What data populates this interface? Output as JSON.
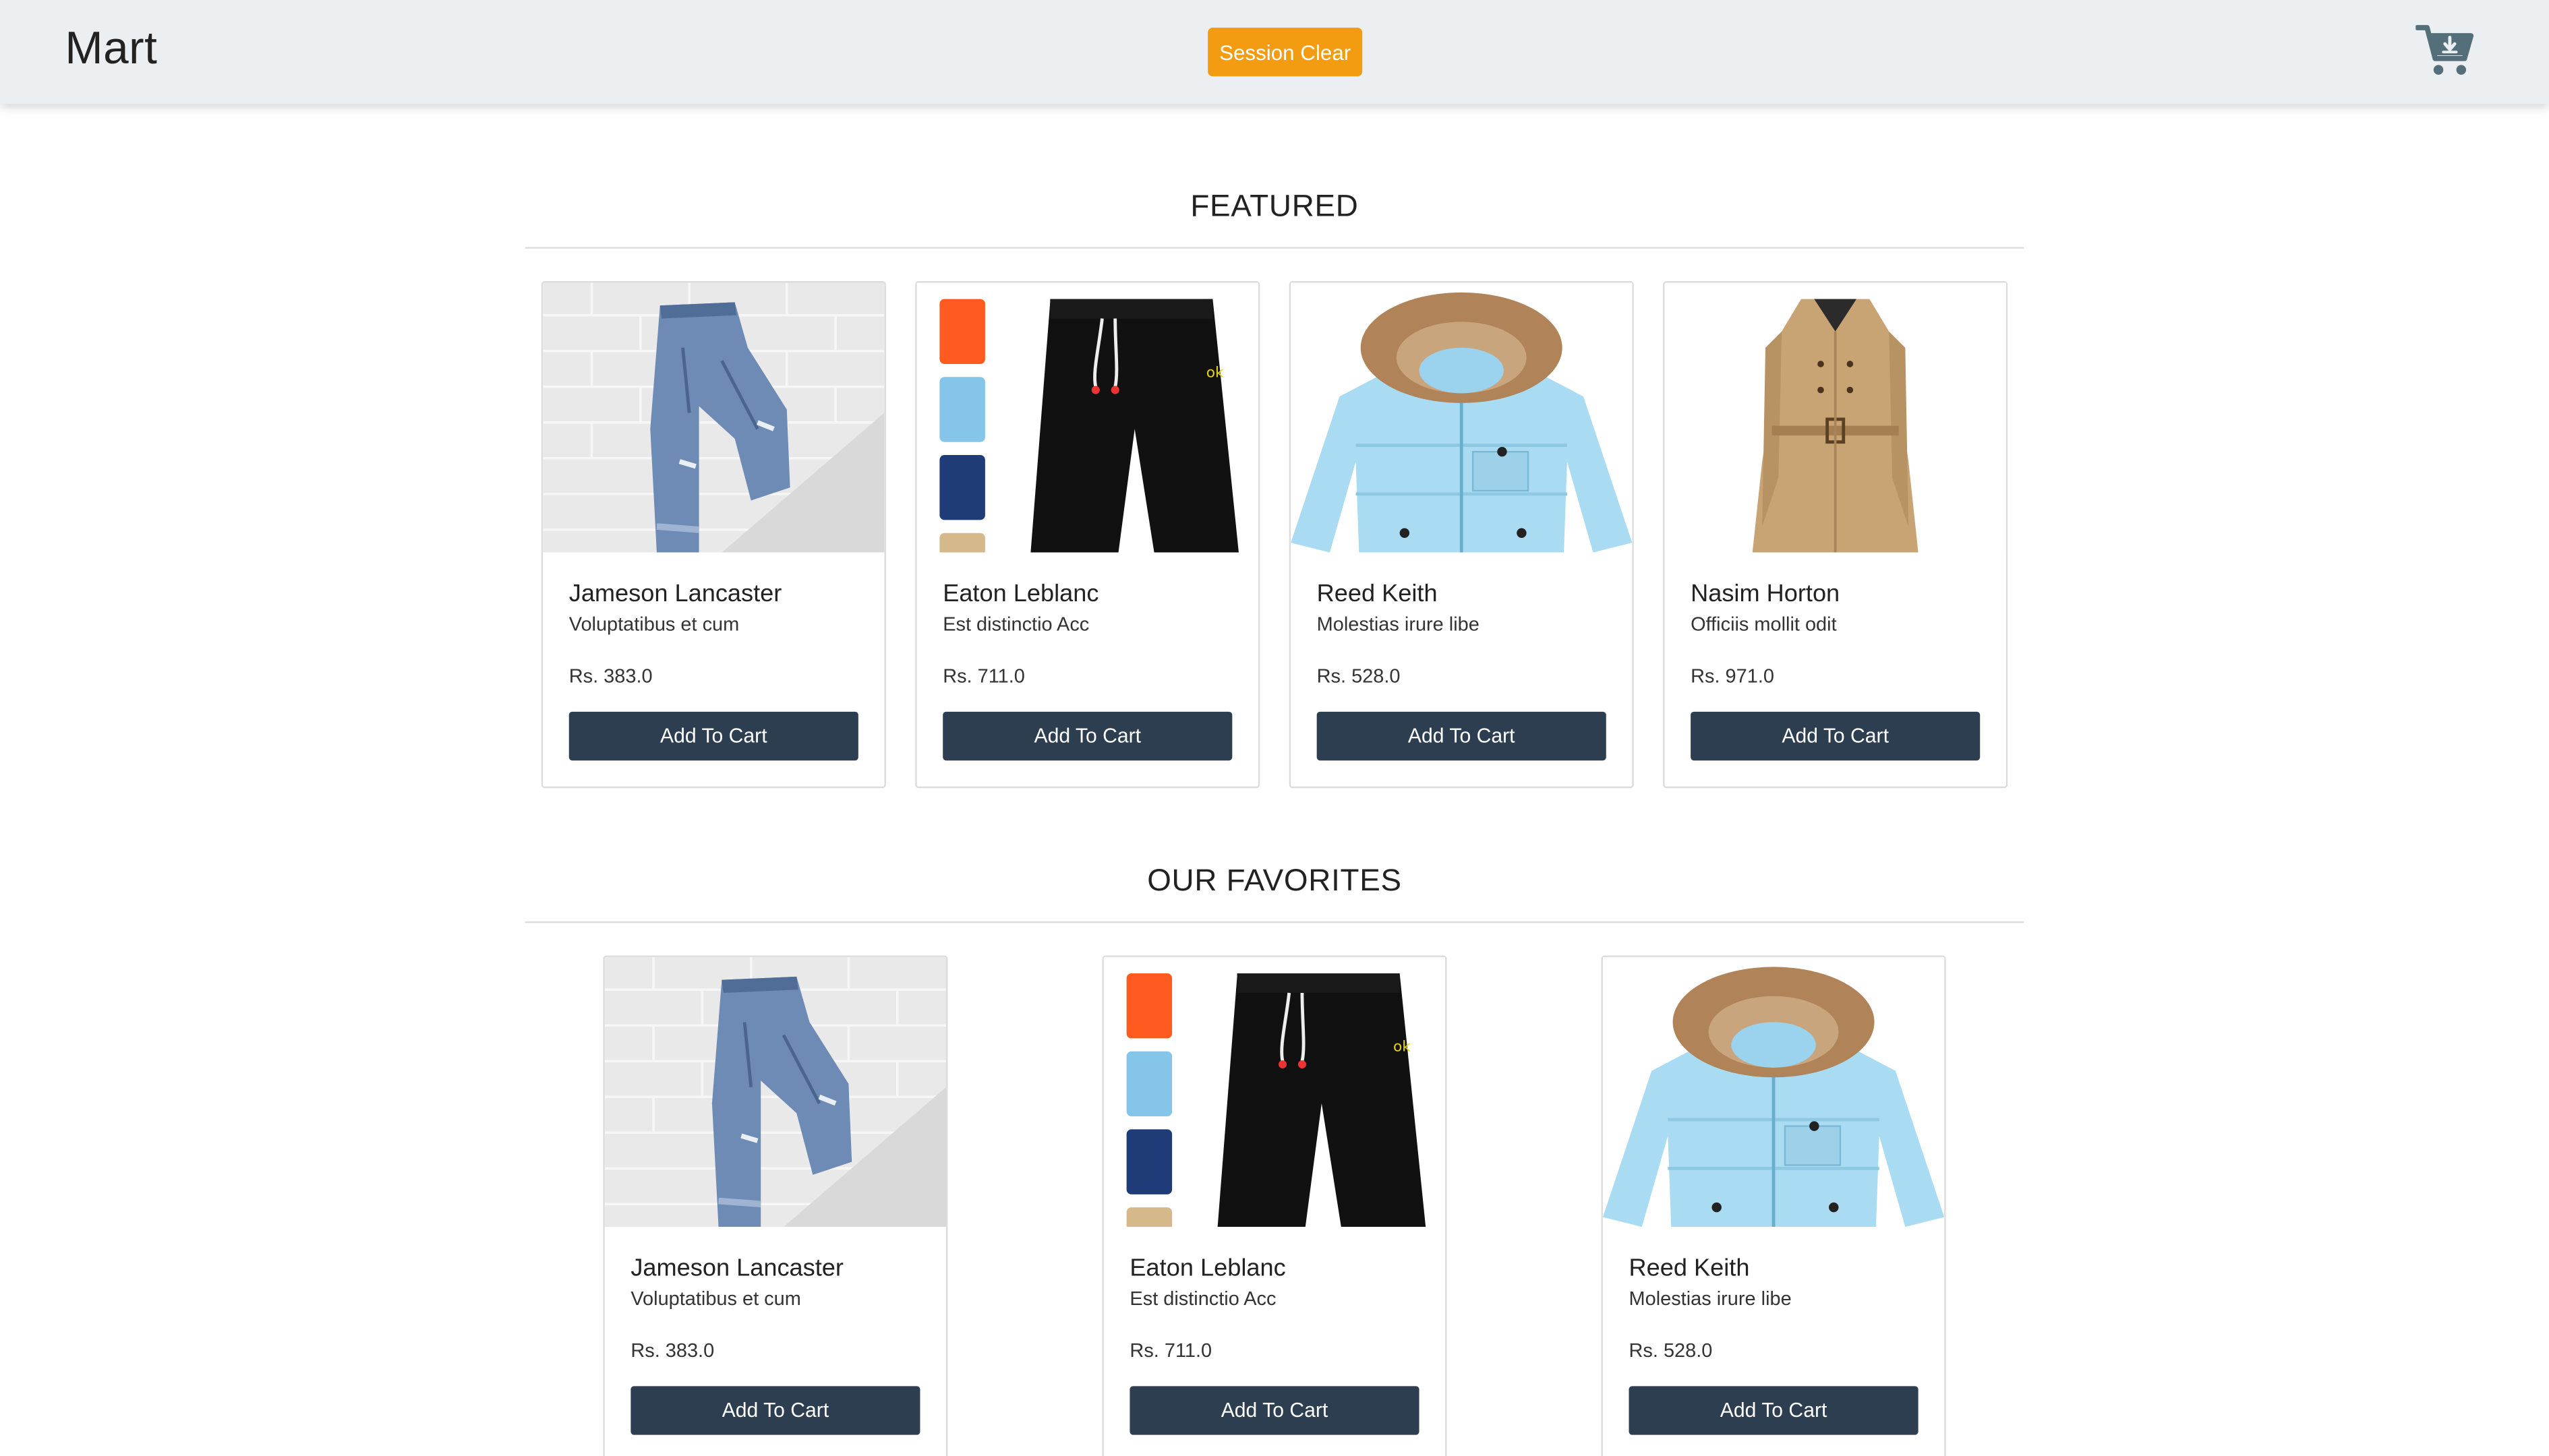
{
  "navbar": {
    "brand": "Mart",
    "session_clear_label": "Session Clear",
    "cart_icon": "cart-download-icon"
  },
  "sections": {
    "featured": {
      "title": "FEATURED",
      "products": [
        {
          "name": "Jameson Lancaster",
          "desc": "Voluptatibus et cum",
          "price": "Rs. 383.0",
          "button": "Add To Cart",
          "image": "jeans"
        },
        {
          "name": "Eaton Leblanc",
          "desc": "Est distinctio Acc",
          "price": "Rs. 711.0",
          "button": "Add To Cart",
          "image": "shorts"
        },
        {
          "name": "Reed Keith",
          "desc": "Molestias irure libe",
          "price": "Rs. 528.0",
          "button": "Add To Cart",
          "image": "puffer-jacket"
        },
        {
          "name": "Nasim Horton",
          "desc": "Officiis mollit odit",
          "price": "Rs. 971.0",
          "button": "Add To Cart",
          "image": "trench-coat"
        }
      ]
    },
    "favorites": {
      "title": "OUR FAVORITES",
      "products": [
        {
          "name": "Jameson Lancaster",
          "desc": "Voluptatibus et cum",
          "price": "Rs. 383.0",
          "button": "Add To Cart",
          "image": "jeans"
        },
        {
          "name": "Eaton Leblanc",
          "desc": "Est distinctio Acc",
          "price": "Rs. 711.0",
          "button": "Add To Cart",
          "image": "shorts"
        },
        {
          "name": "Reed Keith",
          "desc": "Molestias irure libe",
          "price": "Rs. 528.0",
          "button": "Add To Cart",
          "image": "puffer-jacket"
        }
      ]
    }
  },
  "colors": {
    "navbar_bg": "#eceff1",
    "accent_orange": "#f39c12",
    "button_dark": "#2c3e50",
    "cart_icon": "#546e7a"
  }
}
